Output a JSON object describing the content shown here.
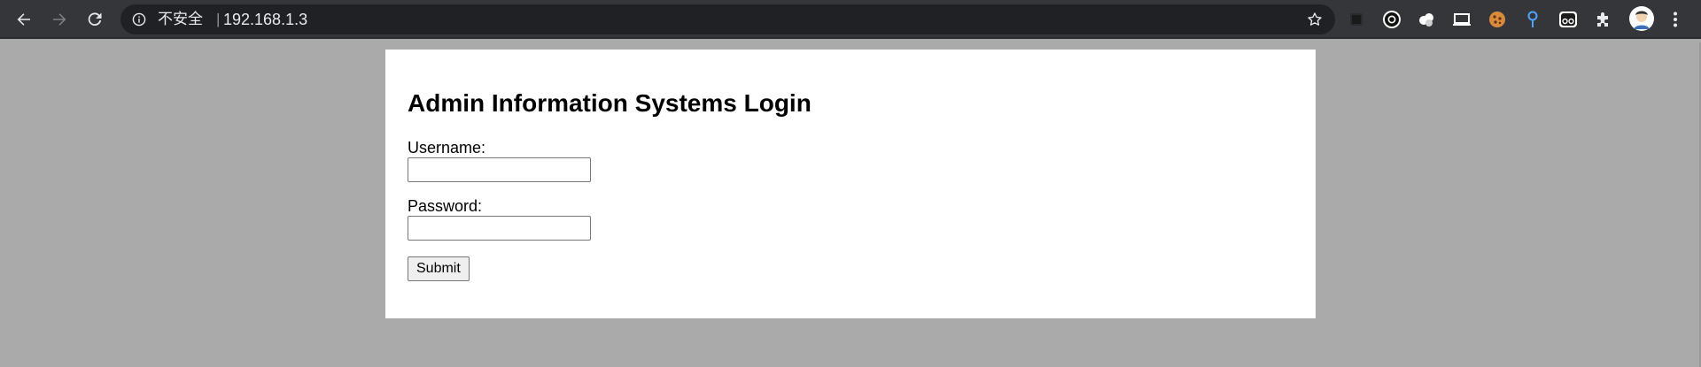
{
  "browser": {
    "security_label": "不安全",
    "separator": "|",
    "url": "192.168.1.3"
  },
  "extensions": [
    {
      "name": "ext-dark-square-icon"
    },
    {
      "name": "ext-black-circle-icon"
    },
    {
      "name": "ext-cloud-icon"
    },
    {
      "name": "ext-laptop-icon"
    },
    {
      "name": "ext-cookie-icon"
    },
    {
      "name": "ext-pin-icon"
    },
    {
      "name": "ext-glasses-icon"
    },
    {
      "name": "ext-puzzle-icon"
    },
    {
      "name": "profile-avatar"
    },
    {
      "name": "menu-icon"
    }
  ],
  "page": {
    "title": "Admin Information Systems Login",
    "username_label": "Username:",
    "username_value": "",
    "password_label": "Password:",
    "password_value": "",
    "submit_label": "Submit"
  },
  "colors": {
    "page_background": "#aaaaaa",
    "card_background": "#ffffff",
    "toolbar_background": "#35363a",
    "omnibox_background": "#202124"
  }
}
